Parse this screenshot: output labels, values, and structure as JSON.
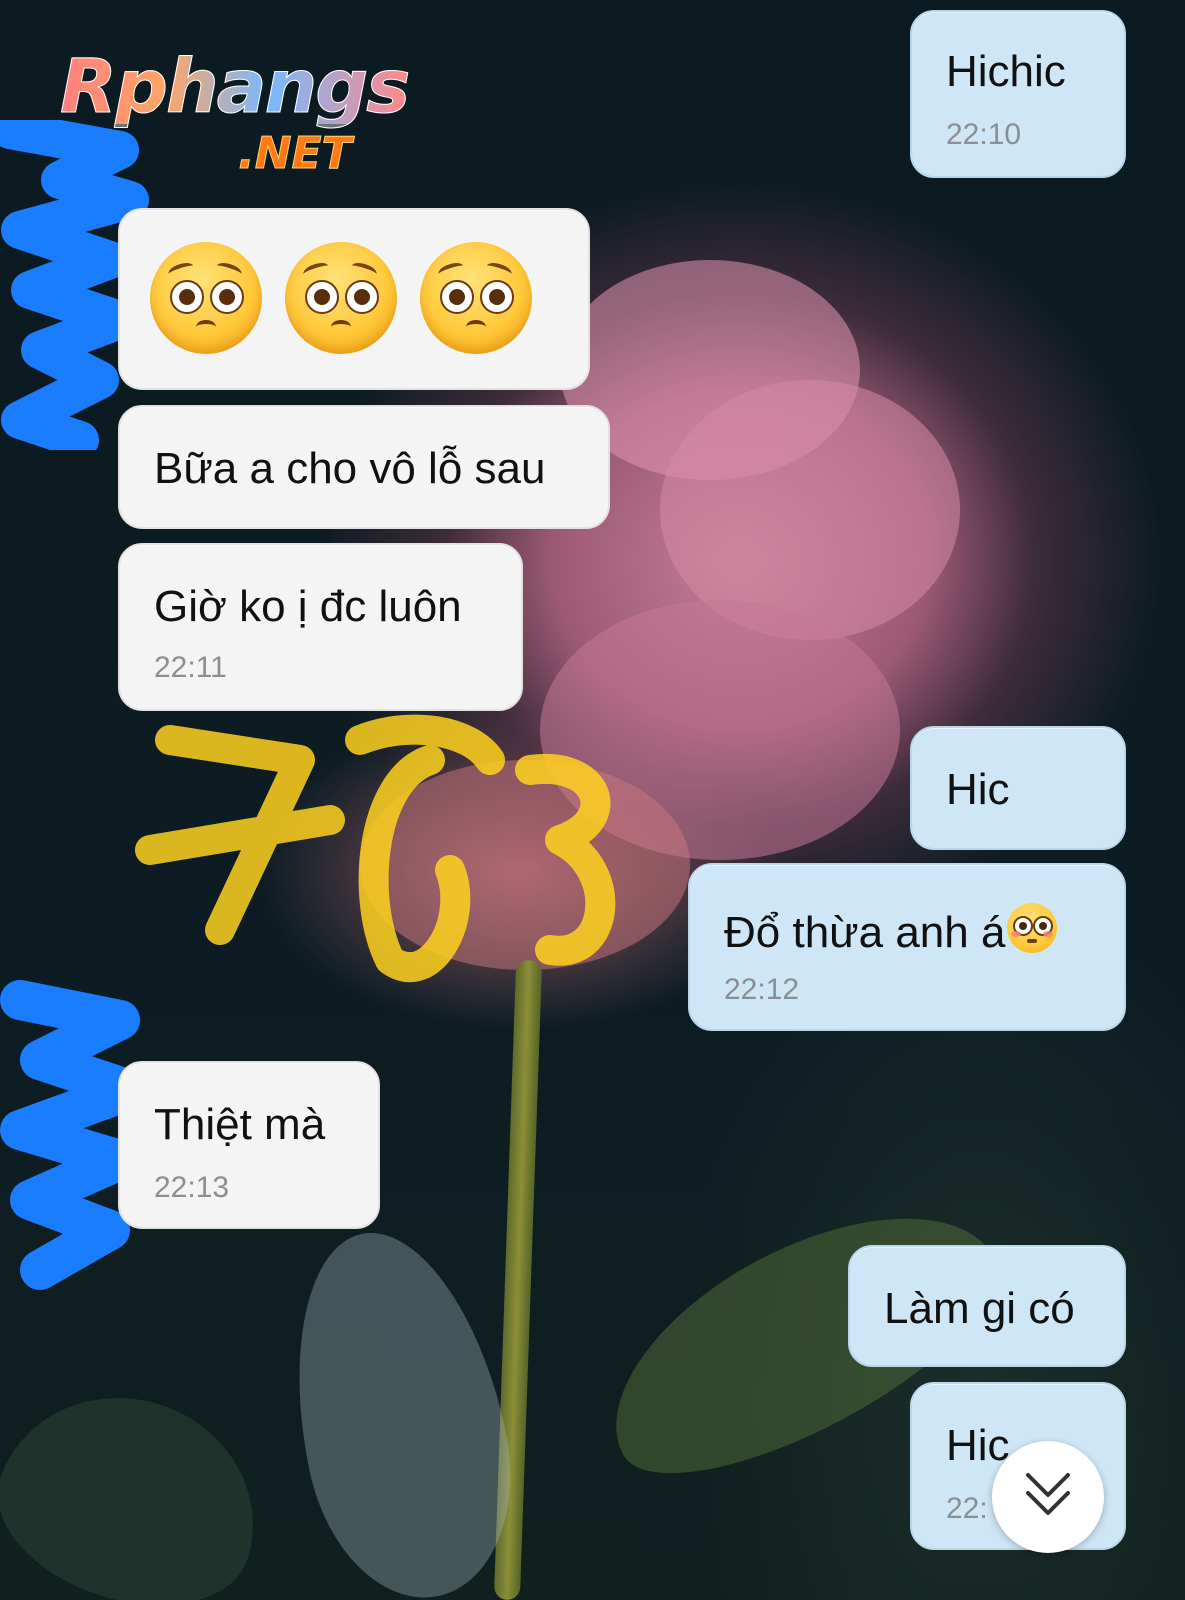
{
  "logo": {
    "main": "Rphangs",
    "sub": ".NET"
  },
  "messages": {
    "m1": {
      "text": "Hichic",
      "time": "22:10"
    },
    "m2": {
      "emojis": [
        "pleading-face",
        "pleading-face",
        "pleading-face"
      ]
    },
    "m3": {
      "text": "Bữa a cho vô lỗ sau"
    },
    "m4": {
      "text": "Giờ ko ị đc luôn",
      "time": "22:11"
    },
    "m5": {
      "text": "Hic"
    },
    "m6": {
      "text": "Đổ thừa anh á",
      "emoji": "flushed-face",
      "time": "22:12"
    },
    "m7": {
      "text": "Thiệt mà",
      "time": "22:13"
    },
    "m8": {
      "text": "Làm gi có"
    },
    "m9": {
      "text": "Hic",
      "time": "22:"
    }
  },
  "scroll_button": {
    "icon": "double-chevron-down-icon"
  },
  "colors": {
    "incoming_bubble": "#f4f4f4",
    "outgoing_bubble": "#cfe6f6",
    "time_text": "#8a8f94",
    "redaction_blue": "#1a7cff",
    "redaction_yellow": "#ffd21e"
  }
}
